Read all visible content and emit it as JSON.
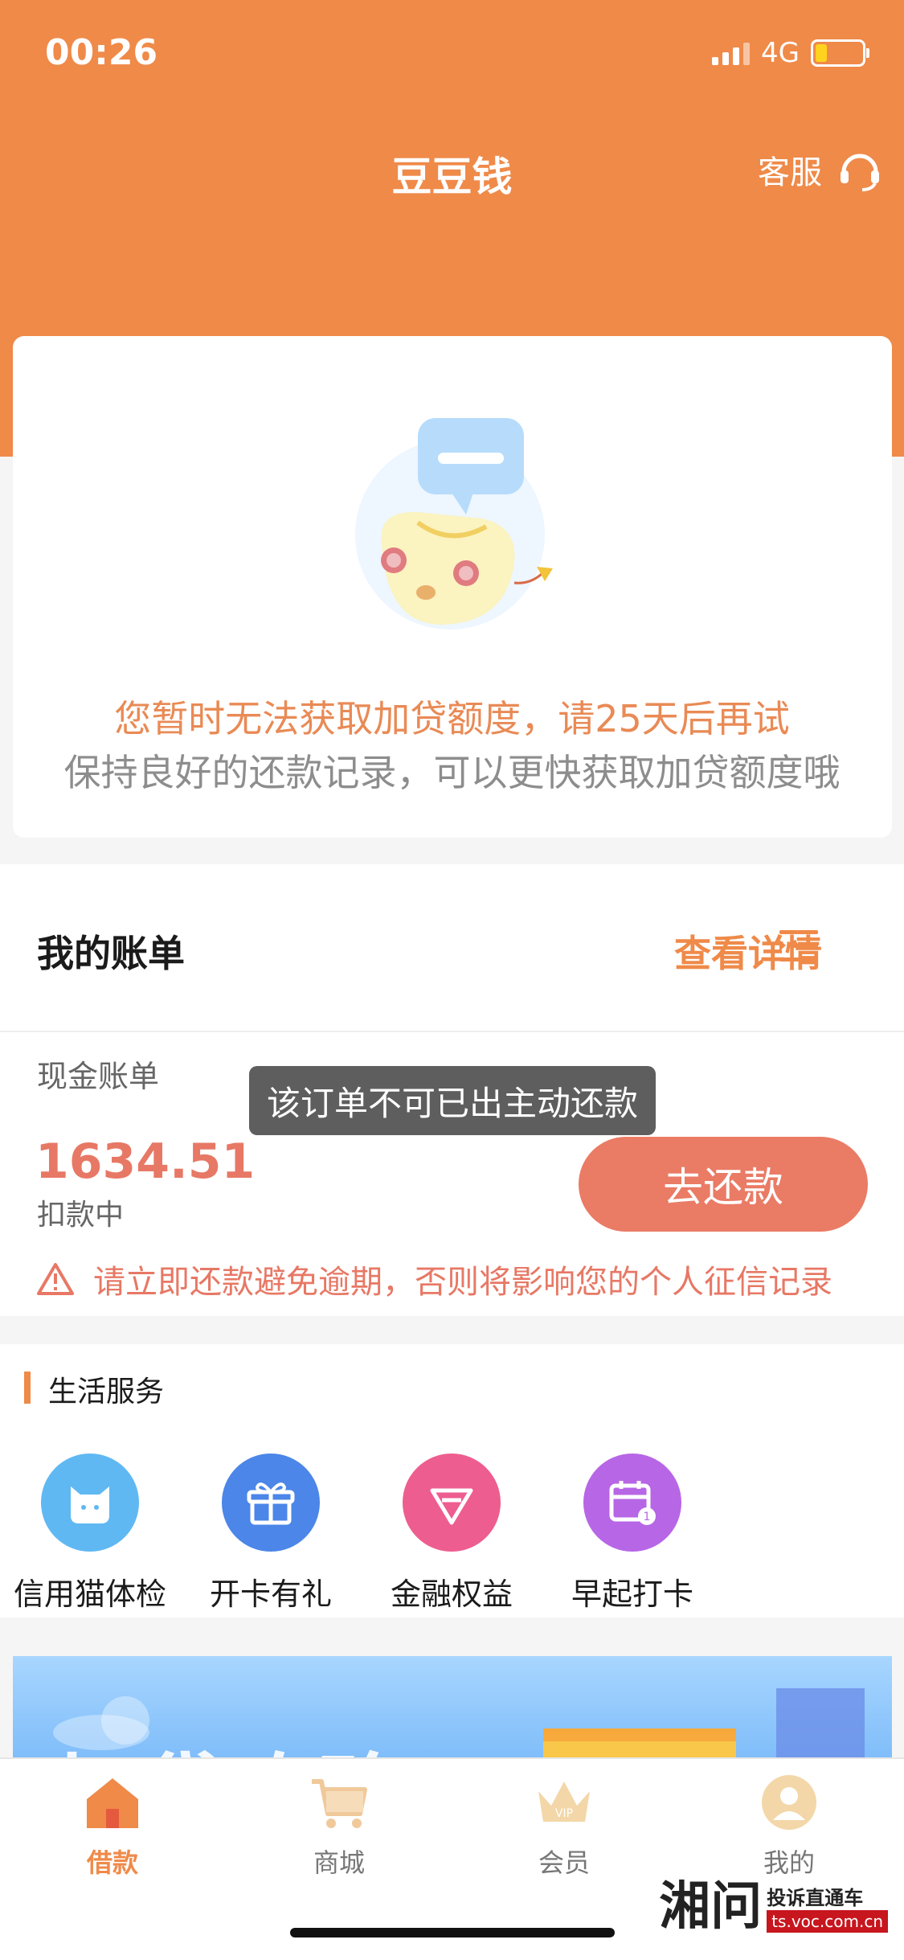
{
  "status": {
    "time": "00:26",
    "network": "4G"
  },
  "header": {
    "title": "豆豆钱",
    "service_label": "客服"
  },
  "quota": {
    "message": "您暂时无法获取加贷额度，请25天后再试",
    "tip": "保持良好的还款记录，可以更快获取加贷额度哦"
  },
  "bill": {
    "title": "我的账单",
    "detail_link": "查看详情",
    "cash_label": "现金账单",
    "amount": "1634.51",
    "status": "扣款中",
    "repay_button": "去还款",
    "toast": "该订单不可已出主动还款",
    "warning": "请立即还款避免逾期，否则将影响您的个人征信记录"
  },
  "life": {
    "title": "生活服务",
    "items": [
      {
        "label": "信用猫体检",
        "icon": "cat-icon",
        "color": "#5fb8f2"
      },
      {
        "label": "开卡有礼",
        "icon": "gift-icon",
        "color": "#4b86e8"
      },
      {
        "label": "金融权益",
        "icon": "diamond-icon",
        "color": "#ee5d8f"
      },
      {
        "label": "早起打卡",
        "icon": "calendar-icon",
        "color": "#b766e6"
      }
    ]
  },
  "banner": {
    "text": "加贷攻略"
  },
  "tabs": [
    {
      "label": "借款",
      "icon": "home-icon",
      "active": true
    },
    {
      "label": "商城",
      "icon": "cart-icon",
      "active": false
    },
    {
      "label": "会员",
      "icon": "crown-icon",
      "active": false
    },
    {
      "label": "我的",
      "icon": "user-icon",
      "active": false
    }
  ],
  "watermark": {
    "brand": "湘问",
    "name": "投诉直通车",
    "url": "ts.voc.com.cn"
  },
  "colors": {
    "accent": "#ef8a49",
    "repay": "#ea7b65",
    "warning": "#e77865"
  }
}
